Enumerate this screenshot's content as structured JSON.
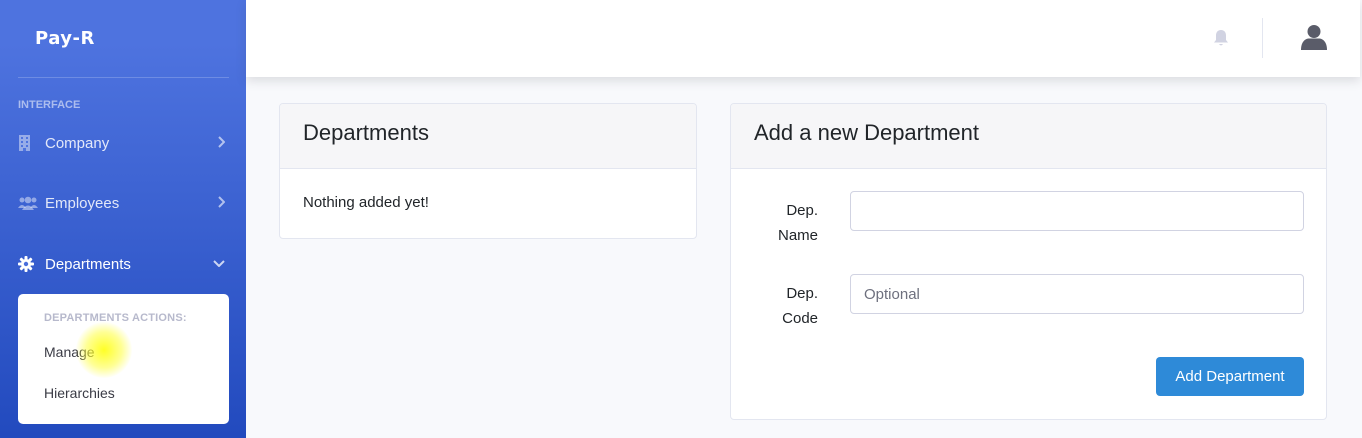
{
  "brand": {
    "name": "Pay-R"
  },
  "sidebar": {
    "heading": "INTERFACE",
    "items": [
      {
        "label": "Company",
        "icon": "building-icon",
        "arrow": "chevron-right-icon"
      },
      {
        "label": "Employees",
        "icon": "users-icon",
        "arrow": "chevron-right-icon"
      },
      {
        "label": "Departments",
        "icon": "gear-icon",
        "arrow": "chevron-down-icon"
      }
    ],
    "submenu": {
      "header": "DEPARTMENTS ACTIONS:",
      "items": [
        {
          "label": "Manage"
        },
        {
          "label": "Hierarchies"
        }
      ]
    }
  },
  "topbar": {
    "icons": [
      "bell-icon",
      "user-avatar-icon"
    ]
  },
  "departments_card": {
    "title": "Departments",
    "empty_text": "Nothing added yet!"
  },
  "add_card": {
    "title": "Add a new Department",
    "name_label_1": "Dep.",
    "name_label_2": "Name",
    "name_value": "",
    "code_label_1": "Dep.",
    "code_label_2": "Code",
    "code_placeholder": "Optional",
    "submit_label": "Add Department"
  },
  "colors": {
    "sidebar": "#4e73df",
    "primary_button": "#2e8ad8",
    "background": "#f8f9fc"
  }
}
